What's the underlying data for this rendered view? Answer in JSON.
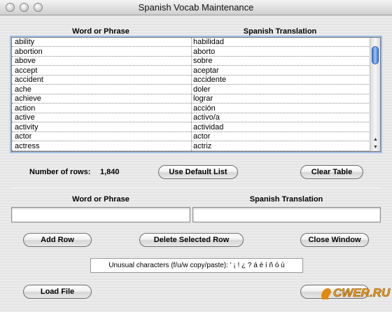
{
  "window": {
    "title": "Spanish Vocab Maintenance"
  },
  "table": {
    "columns": [
      "Word or Phrase",
      "Spanish Translation"
    ],
    "rows": [
      [
        "ability",
        "habilidad"
      ],
      [
        "abortion",
        "aborto"
      ],
      [
        "above",
        "sobre"
      ],
      [
        "accept",
        "aceptar"
      ],
      [
        "accident",
        "accidente"
      ],
      [
        "ache",
        "doler"
      ],
      [
        "achieve",
        "lograr"
      ],
      [
        "action",
        "acción"
      ],
      [
        "active",
        "activo/a"
      ],
      [
        "activity",
        "actividad"
      ],
      [
        "actor",
        "actor"
      ],
      [
        "actress",
        "actriz"
      ]
    ]
  },
  "stats": {
    "rows_label": "Number of rows:",
    "rows_value": "1,840"
  },
  "buttons": {
    "use_default": "Use Default List",
    "clear_table": "Clear Table",
    "add_row": "Add Row",
    "delete_row": "Delete Selected Row",
    "close_window": "Close Window",
    "load_file": "Load File"
  },
  "entry": {
    "word_label": "Word or Phrase",
    "translation_label": "Spanish Translation",
    "word_value": "",
    "translation_value": ""
  },
  "unusual_chars": "Unusual characters (f/u/w copy/paste): ' ¡ ! ¿ ? á é í ñ ó ú",
  "watermark": "CWER.RU"
}
